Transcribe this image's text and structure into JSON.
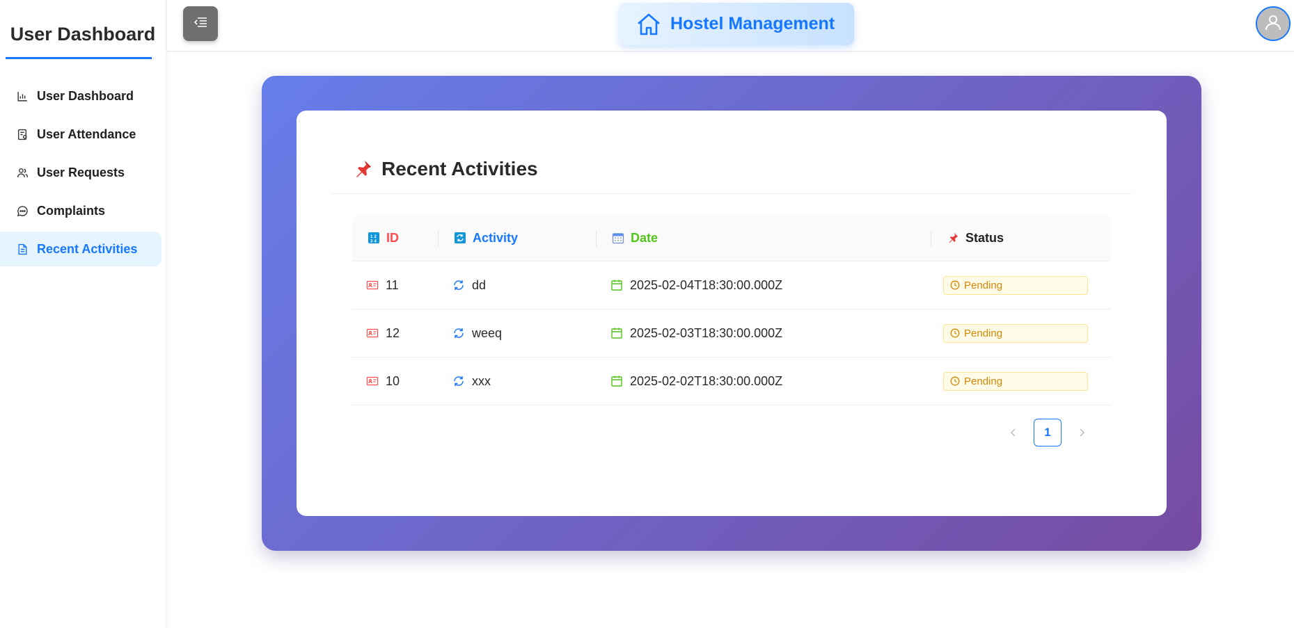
{
  "sidebar": {
    "title": "User Dashboard",
    "items": [
      {
        "label": "User Dashboard",
        "icon": "bar-chart-icon",
        "active": false
      },
      {
        "label": "User Attendance",
        "icon": "attendance-icon",
        "active": false
      },
      {
        "label": "User Requests",
        "icon": "users-icon",
        "active": false
      },
      {
        "label": "Complaints",
        "icon": "message-icon",
        "active": false
      },
      {
        "label": "Recent Activities",
        "icon": "file-icon",
        "active": true
      }
    ]
  },
  "header": {
    "menu_icon": "menu-fold-icon",
    "brand_icon": "home-icon",
    "brand_title": "Hostel Management",
    "avatar_icon": "user-icon"
  },
  "card": {
    "title": "Recent Activities",
    "title_icon": "pushpin-icon"
  },
  "table": {
    "columns": [
      {
        "label": "ID",
        "icon": "number-icon",
        "color": "#ff4d4f"
      },
      {
        "label": "Activity",
        "icon": "sync-icon",
        "color": "#1677ff"
      },
      {
        "label": "Date",
        "icon": "calendar-icon",
        "color": "#52c41a"
      },
      {
        "label": "Status",
        "icon": "pushpin-icon",
        "color": "#222222"
      }
    ],
    "rows": [
      {
        "id": "11",
        "activity": "dd",
        "date": "2025-02-04T18:30:00.000Z",
        "status": "Pending"
      },
      {
        "id": "12",
        "activity": "weeq",
        "date": "2025-02-03T18:30:00.000Z",
        "status": "Pending"
      },
      {
        "id": "10",
        "activity": "xxx",
        "date": "2025-02-02T18:30:00.000Z",
        "status": "Pending"
      }
    ]
  },
  "pagination": {
    "prev_icon": "chevron-left-icon",
    "current_page": "1",
    "next_icon": "chevron-right-icon"
  },
  "colors": {
    "accent": "#1677ff",
    "panel_gradient_start": "#667eea",
    "panel_gradient_end": "#764ba2",
    "pending_text": "#d48806",
    "pending_bg": "#fffbe6"
  }
}
